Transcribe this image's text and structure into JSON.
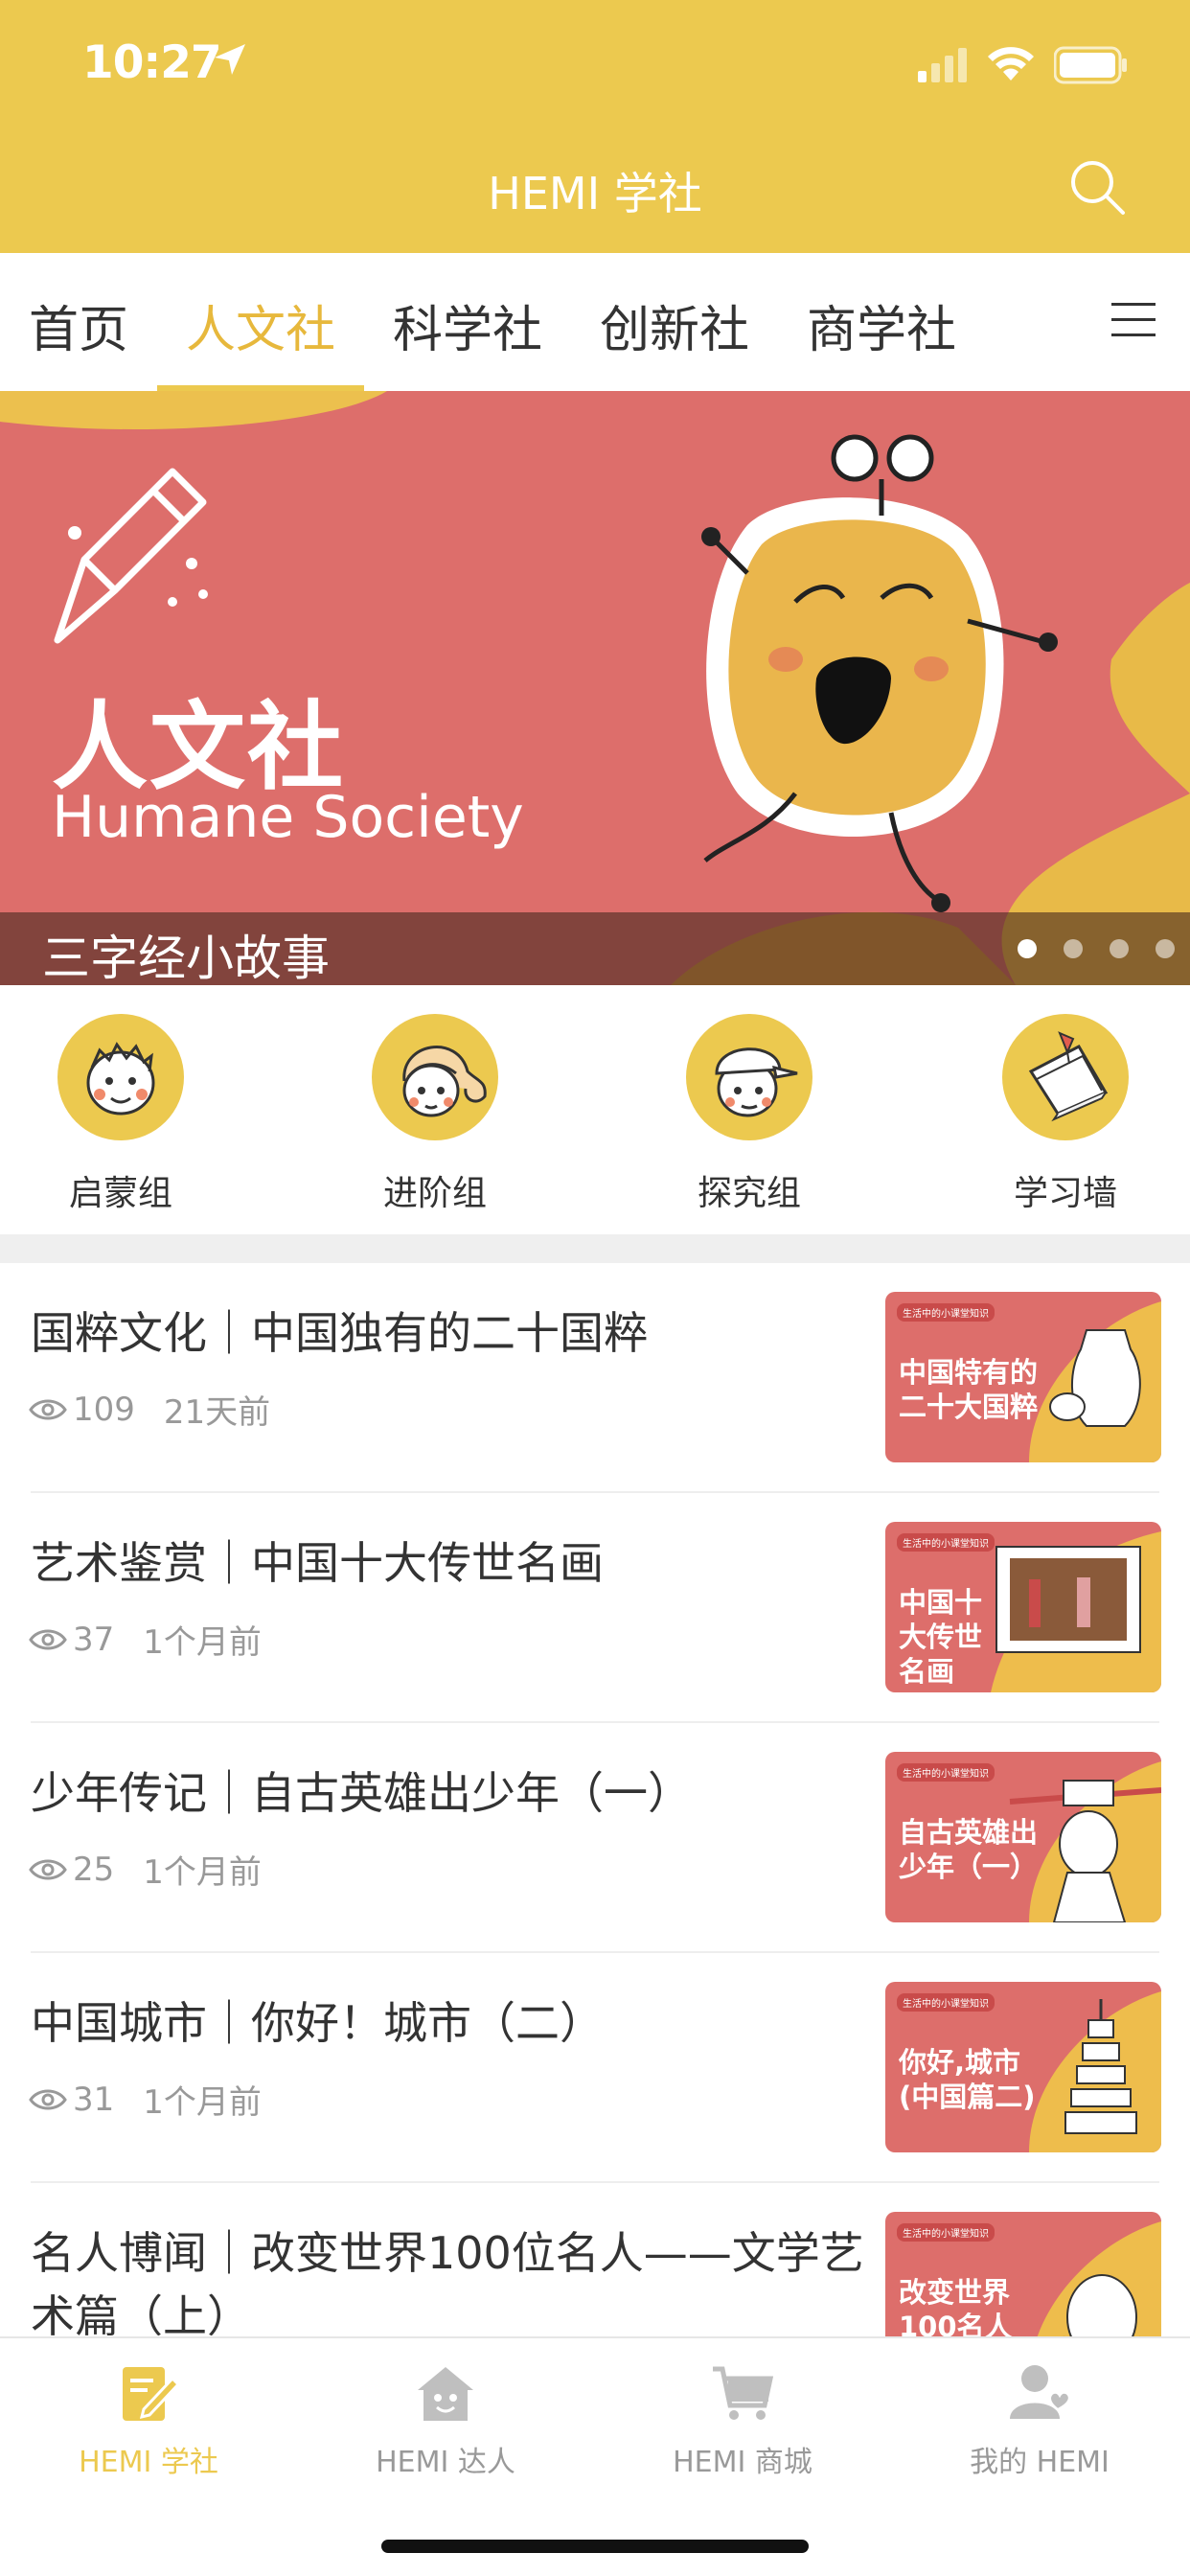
{
  "status_bar": {
    "time": "10:27"
  },
  "header": {
    "title": "HEMI 学社"
  },
  "tabs": [
    {
      "label": "首页"
    },
    {
      "label": "人文社",
      "active": true
    },
    {
      "label": "科学社"
    },
    {
      "label": "创新社"
    },
    {
      "label": "商学社"
    }
  ],
  "banner": {
    "title": "人文社",
    "subtitle": "Humane Society",
    "caption": "三字经小故事",
    "slide_count": 4,
    "active_slide": 1
  },
  "groups": [
    {
      "label": "启蒙组",
      "icon": "boy-avatar-icon"
    },
    {
      "label": "进阶组",
      "icon": "girl-avatar-icon"
    },
    {
      "label": "探究组",
      "icon": "cap-boy-avatar-icon"
    },
    {
      "label": "学习墙",
      "icon": "notes-icon"
    }
  ],
  "articles": [
    {
      "title": "国粹文化｜中国独有的二十国粹",
      "views": "109",
      "time": "21天前",
      "thumb_tag": "生活中的小课堂知识",
      "thumb_text": "中国特有的二十大国粹"
    },
    {
      "title": "艺术鉴赏｜中国十大传世名画",
      "views": "37",
      "time": "1个月前",
      "thumb_tag": "生活中的小课堂知识",
      "thumb_text": "中国十大传世名画"
    },
    {
      "title": "少年传记｜自古英雄出少年（一）",
      "views": "25",
      "time": "1个月前",
      "thumb_tag": "生活中的小课堂知识",
      "thumb_text": "自古英雄出少年（一）"
    },
    {
      "title": "中国城市｜你好！城市（二）",
      "views": "31",
      "time": "1个月前",
      "thumb_tag": "生活中的小课堂知识",
      "thumb_text": "你好,城市(中国篇二)"
    },
    {
      "title": "名人博闻｜改变世界100位名人——文学艺术篇（上）",
      "views": "",
      "time": "",
      "thumb_tag": "生活中的小课堂知识",
      "thumb_text": "改变世界100名人"
    }
  ],
  "bottom_nav": [
    {
      "label": "HEMI 学社",
      "icon": "notebook-pen-icon",
      "active": true
    },
    {
      "label": "HEMI 达人",
      "icon": "house-face-icon"
    },
    {
      "label": "HEMI 商城",
      "icon": "cart-icon"
    },
    {
      "label": "我的 HEMI",
      "icon": "user-heart-icon"
    }
  ],
  "colors": {
    "brand_yellow": "#ecc94f",
    "active_tab": "#e7b83c",
    "banner_red": "#dd6e6b",
    "text": "#333333",
    "muted": "#999999"
  }
}
